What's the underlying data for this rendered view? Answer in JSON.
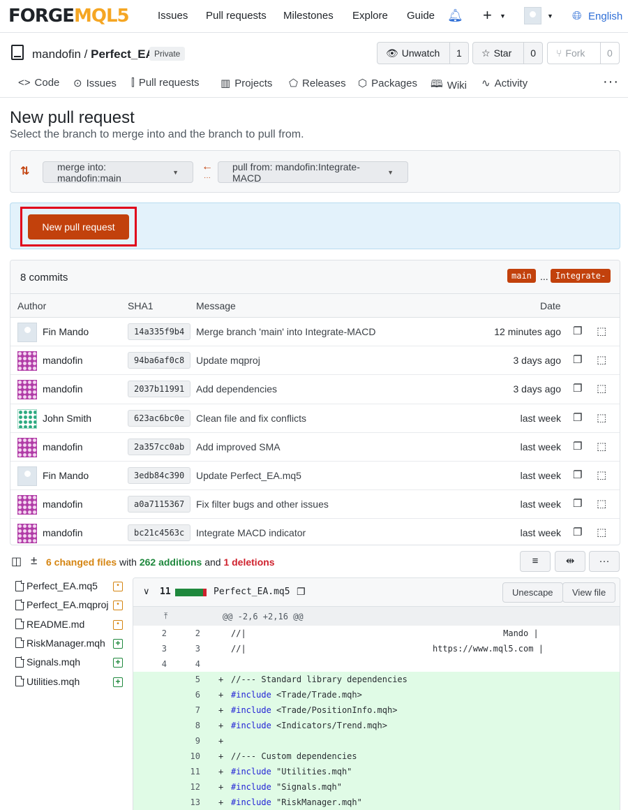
{
  "brand": {
    "part1": "FORGE",
    "part2": "MQL5"
  },
  "topnav": {
    "links": [
      "Issues",
      "Pull requests",
      "Milestones",
      "Explore",
      "Guide"
    ],
    "language": "English"
  },
  "repo": {
    "owner": "mandofin",
    "separator": " / ",
    "name": "Perfect_EA",
    "visibility": "Private",
    "watch_label": "Unwatch",
    "watch_count": "1",
    "star_label": "Star",
    "star_count": "0",
    "fork_label": "Fork",
    "fork_count": "0"
  },
  "tabs": [
    "Code",
    "Issues",
    "Pull requests",
    "Projects",
    "Releases",
    "Packages",
    "Wiki",
    "Activity"
  ],
  "page": {
    "title": "New pull request",
    "subtitle": "Select the branch to merge into and the branch to pull from."
  },
  "compare": {
    "base": "merge into: mandofin:main",
    "head": "pull from: mandofin:Integrate-MACD"
  },
  "action": {
    "button": "New pull request"
  },
  "commits": {
    "count_label": "8 commits",
    "base_tag": "main",
    "dots": "...",
    "head_tag": "Integrate-",
    "columns": {
      "author": "Author",
      "sha": "SHA1",
      "message": "Message",
      "date": "Date"
    },
    "rows": [
      {
        "author": "Fin Mando",
        "avatar": "placeholder",
        "sha": "14a335f9b4",
        "message": "Merge branch 'main' into Integrate-MACD",
        "date": "12 minutes ago"
      },
      {
        "author": "mandofin",
        "avatar": "pink-pattern",
        "sha": "94ba6af0c8",
        "message": "Update mqproj",
        "date": "3 days ago"
      },
      {
        "author": "mandofin",
        "avatar": "pink-pattern",
        "sha": "2037b11991",
        "message": "Add dependencies",
        "date": "3 days ago"
      },
      {
        "author": "John Smith",
        "avatar": "green-pattern",
        "sha": "623ac6bc0e",
        "message": "Clean file and fix conflicts",
        "date": "last week"
      },
      {
        "author": "mandofin",
        "avatar": "pink-pattern",
        "sha": "2a357cc0ab",
        "message": "Add improved SMA",
        "date": "last week"
      },
      {
        "author": "Fin Mando",
        "avatar": "placeholder",
        "sha": "3edb84c390",
        "message": "Update Perfect_EA.mq5",
        "date": "last week"
      },
      {
        "author": "mandofin",
        "avatar": "pink-pattern",
        "sha": "a0a7115367",
        "message": "Fix filter bugs and other issues",
        "date": "last week"
      },
      {
        "author": "mandofin",
        "avatar": "pink-pattern",
        "sha": "bc21c4563c",
        "message": "Integrate MACD indicator",
        "date": "last week"
      }
    ]
  },
  "diffstat": {
    "files": "6 changed files",
    "with": " with ",
    "additions": "262 additions",
    "and": " and ",
    "deletions": "1 deletions"
  },
  "files": [
    {
      "name": "Perfect_EA.mq5",
      "status": "modified"
    },
    {
      "name": "Perfect_EA.mqproj",
      "status": "modified"
    },
    {
      "name": "README.md",
      "status": "modified"
    },
    {
      "name": "RiskManager.mqh",
      "status": "added"
    },
    {
      "name": "Signals.mqh",
      "status": "added"
    },
    {
      "name": "Utilities.mqh",
      "status": "added"
    }
  ],
  "diff": {
    "changes": "11",
    "filename": "Perfect_EA.mq5",
    "unescape": "Unescape",
    "view_file": "View file",
    "hunk": "@@ -2,6 +2,16 @@",
    "lines": [
      {
        "old": "2",
        "new": "2",
        "sign": "",
        "kw": "",
        "text": "//|                                                   Mando |",
        "add": false
      },
      {
        "old": "3",
        "new": "3",
        "sign": "",
        "kw": "",
        "text": "//|                                     https://www.mql5.com |",
        "add": false
      },
      {
        "old": "4",
        "new": "4",
        "sign": "",
        "kw": "",
        "text": "",
        "add": false
      },
      {
        "old": "",
        "new": "5",
        "sign": "+",
        "kw": "",
        "text": "//--- Standard library dependencies",
        "add": true
      },
      {
        "old": "",
        "new": "6",
        "sign": "+",
        "kw": "#include",
        "text": " <Trade/Trade.mqh>",
        "add": true
      },
      {
        "old": "",
        "new": "7",
        "sign": "+",
        "kw": "#include",
        "text": " <Trade/PositionInfo.mqh>",
        "add": true
      },
      {
        "old": "",
        "new": "8",
        "sign": "+",
        "kw": "#include",
        "text": " <Indicators/Trend.mqh>",
        "add": true
      },
      {
        "old": "",
        "new": "9",
        "sign": "+",
        "kw": "",
        "text": "",
        "add": true
      },
      {
        "old": "",
        "new": "10",
        "sign": "+",
        "kw": "",
        "text": "//--- Custom dependencies",
        "add": true
      },
      {
        "old": "",
        "new": "11",
        "sign": "+",
        "kw": "#include",
        "text": " \"Utilities.mqh\"",
        "add": true
      },
      {
        "old": "",
        "new": "12",
        "sign": "+",
        "kw": "#include",
        "text": " \"Signals.mqh\"",
        "add": true
      },
      {
        "old": "",
        "new": "13",
        "sign": "+",
        "kw": "#include",
        "text": " \"RiskManager.mqh\"",
        "add": true
      }
    ]
  },
  "colors": {
    "accent": "#c2410c",
    "link": "#2f6fd6",
    "added": "#1f883d",
    "deleted": "#cf222e",
    "modified": "#d58512"
  }
}
